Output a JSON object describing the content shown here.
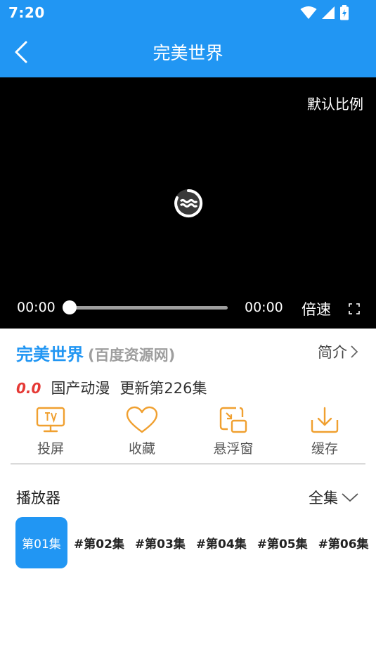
{
  "status": {
    "time": "7:20"
  },
  "header": {
    "title": "完美世界",
    "back_icon": "chevron-left-icon"
  },
  "player": {
    "ratio_label": "默认比例",
    "current_time": "00:00",
    "total_time": "00:00",
    "speed_label": "倍速",
    "progress": 0
  },
  "info": {
    "title": "完美世界",
    "source": "(百度资源网)",
    "intro_label": "简介",
    "score": "0.0",
    "genre": "国产动漫",
    "update": "更新第226集"
  },
  "actions": [
    {
      "label": "投屏",
      "icon": "tv-cast-icon"
    },
    {
      "label": "收藏",
      "icon": "heart-icon"
    },
    {
      "label": "悬浮窗",
      "icon": "floating-window-icon"
    },
    {
      "label": "缓存",
      "icon": "download-icon"
    }
  ],
  "player_section": {
    "title": "播放器",
    "all_label": "全集"
  },
  "episodes": [
    "第01集",
    "#第02集",
    "#第03集",
    "#第04集",
    "#第05集",
    "#第06集"
  ],
  "colors": {
    "accent": "#2196f3",
    "action_icon": "#f0a030",
    "score": "#e53935"
  }
}
